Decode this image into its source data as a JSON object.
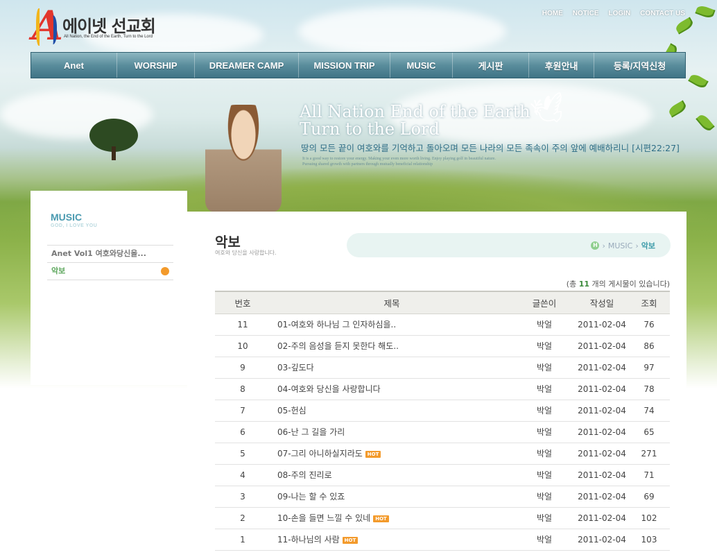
{
  "header": {
    "logo_title": "에이넷 선교회",
    "logo_sub": "All Nation, the End of the Earth, Turn to the Lord",
    "top_links": [
      "HOME",
      "NOTICE",
      "LOGIN",
      "CONTACT US"
    ]
  },
  "nav": {
    "items": [
      "Anet",
      "WORSHIP",
      "DREAMER CAMP",
      "MISSION TRIP",
      "MUSIC",
      "게시판",
      "후원안내",
      "등록/지역신청"
    ]
  },
  "banner": {
    "line1": "All Nation End of the Earth",
    "line2": "Turn to the Lord",
    "korean": "땅의 모든 끝이 여호와를 기억하고 돌아오며 모든 나라의 모든 족속이 주의 앞에 예배하리니 [시편22:27]",
    "small1": "It is a good way to restore your energy. Making your even more worth living. Enjoy playing golf in beautiful nature.",
    "small2": "Pursuing shared growth with partners through mutually beneficial relationship"
  },
  "sidebar": {
    "title": "MUSIC",
    "subtitle": "GOD, I LOVE YOU",
    "items": [
      {
        "label": "Anet Vol1 여호와당신을..."
      },
      {
        "label": "악보"
      }
    ]
  },
  "main": {
    "title": "악보",
    "subtitle": "여호와 당신을 사랑합니다.",
    "breadcrumb": {
      "home": "H",
      "section": "MUSIC",
      "current": "악보"
    },
    "total_prefix": "(총 ",
    "total_count": "11",
    "total_suffix": " 개의 게시물이 있습니다)",
    "columns": [
      "번호",
      "제목",
      "글쓴이",
      "작성일",
      "조회"
    ],
    "hot_label": "HOT",
    "rows": [
      {
        "no": "11",
        "title": "01-여호와 하나님 그 인자하심을..",
        "author": "박얼",
        "date": "2011-02-04",
        "views": "76",
        "hot": false
      },
      {
        "no": "10",
        "title": "02-주의 음성을 듣지 못한다 해도..",
        "author": "박얼",
        "date": "2011-02-04",
        "views": "86",
        "hot": false
      },
      {
        "no": "9",
        "title": "03-깊도다",
        "author": "박얼",
        "date": "2011-02-04",
        "views": "97",
        "hot": false
      },
      {
        "no": "8",
        "title": "04-여호와 당신을 사랑합니다",
        "author": "박얼",
        "date": "2011-02-04",
        "views": "78",
        "hot": false
      },
      {
        "no": "7",
        "title": "05-헌심",
        "author": "박얼",
        "date": "2011-02-04",
        "views": "74",
        "hot": false
      },
      {
        "no": "6",
        "title": "06-난 그 길을 가리",
        "author": "박얼",
        "date": "2011-02-04",
        "views": "65",
        "hot": false
      },
      {
        "no": "5",
        "title": "07-그리 아니하실지라도",
        "author": "박얼",
        "date": "2011-02-04",
        "views": "271",
        "hot": true
      },
      {
        "no": "4",
        "title": "08-주의 진리로",
        "author": "박얼",
        "date": "2011-02-04",
        "views": "71",
        "hot": false
      },
      {
        "no": "3",
        "title": "09-나는 할 수 있죠",
        "author": "박얼",
        "date": "2011-02-04",
        "views": "69",
        "hot": false
      },
      {
        "no": "2",
        "title": "10-손을 들면 느낄 수 있네",
        "author": "박얼",
        "date": "2011-02-04",
        "views": "102",
        "hot": true
      },
      {
        "no": "1",
        "title": "11-하나님의 사람",
        "author": "박얼",
        "date": "2011-02-04",
        "views": "103",
        "hot": true
      }
    ]
  }
}
